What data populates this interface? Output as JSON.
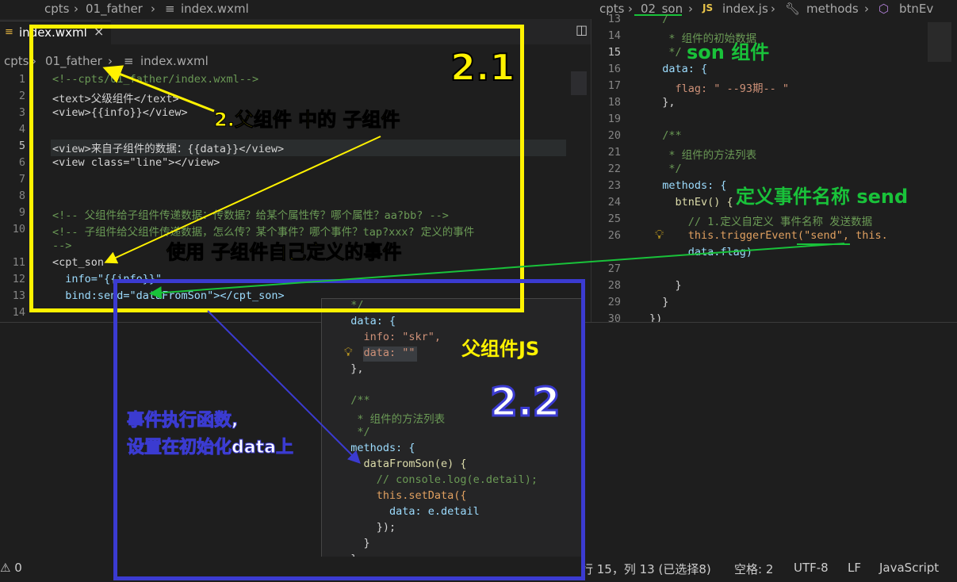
{
  "top_breadcrumb_left": {
    "seg1": "cpts",
    "seg2": "01_father",
    "seg3": "index.wxml"
  },
  "top_breadcrumb_right": {
    "seg1": "cpts",
    "seg2": "02_son",
    "seg3": "index.js",
    "seg4": "methods",
    "seg5": "btnEv",
    "js_badge": "JS"
  },
  "left_editor": {
    "tab_label": "index.wxml",
    "breadcrumb": {
      "seg1": "cpts",
      "seg2": "01_father",
      "seg3": "index.wxml"
    },
    "lines": [
      {
        "n": "1",
        "t": "<!--cpts/01_father/index.wxml-->"
      },
      {
        "n": "2",
        "t": "<text>父级组件</text>"
      },
      {
        "n": "3",
        "t": "<view>{{info}}</view>"
      },
      {
        "n": "4",
        "t": ""
      },
      {
        "n": "5",
        "t": "<view>来自子组件的数据：{{data}}</view>"
      },
      {
        "n": "6",
        "t": "<view class=\"line\"></view>"
      },
      {
        "n": "7",
        "t": ""
      },
      {
        "n": "8",
        "t": ""
      },
      {
        "n": "9",
        "t": "<!-- 父组件给子组件传递数据：传数据？给某个属性传？哪个属性？aa?bb? -->"
      },
      {
        "n": "10",
        "t": "<!-- 子组件给父组件传递数据，怎么传？某个事件？哪个事件？tap?xxx? 定义的事件"
      },
      {
        "n": "",
        "t": "-->"
      },
      {
        "n": "11",
        "t": "<cpt_son"
      },
      {
        "n": "12",
        "t": "  info=\"{{info}}\""
      },
      {
        "n": "13",
        "t": "  bind:send=\"dataFromSon\"></cpt_son>"
      },
      {
        "n": "14",
        "t": ""
      }
    ]
  },
  "right_editor": {
    "lines": [
      {
        "n": "13",
        "t": "  /"
      },
      {
        "n": "14",
        "t": "   * 组件的初始数据"
      },
      {
        "n": "15",
        "t": "   */"
      },
      {
        "n": "16",
        "t": "  data: {"
      },
      {
        "n": "17",
        "t": "    flag: \" --93期-- \""
      },
      {
        "n": "18",
        "t": "  },"
      },
      {
        "n": "19",
        "t": ""
      },
      {
        "n": "20",
        "t": "  /**"
      },
      {
        "n": "21",
        "t": "   * 组件的方法列表"
      },
      {
        "n": "22",
        "t": "   */"
      },
      {
        "n": "23",
        "t": "  methods: {"
      },
      {
        "n": "24",
        "t": "    btnEv() {"
      },
      {
        "n": "25",
        "t": "      // 1.定义自定义 事件名称 发送数据"
      },
      {
        "n": "26",
        "t": "      this.triggerEvent(\"send\", this."
      },
      {
        "n": "",
        "t": "      data.flag)"
      },
      {
        "n": "27",
        "t": ""
      },
      {
        "n": "28",
        "t": "    }"
      },
      {
        "n": "29",
        "t": "  }"
      },
      {
        "n": "30",
        "t": "})"
      }
    ]
  },
  "popup_code": {
    "lines": [
      "  */",
      "  data: {",
      "    info: \"skr\",",
      "    data: \"\"",
      "  },",
      "",
      "  /**",
      "   * 组件的方法列表",
      "   */",
      "  methods: {",
      "    dataFromSon(e) {",
      "      // console.log(e.detail);",
      "      this.setData({",
      "        data: e.detail",
      "      });",
      "    }",
      "  }",
      "})"
    ]
  },
  "annotations": {
    "label_2_1": "2.1",
    "label_2_2": "2.2",
    "father_child": "2.父组件 中的 子组件",
    "use_event": "使用 子组件自己定义的事件",
    "son_component": "son 组件",
    "define_event": "定义事件名称 send",
    "father_js": "父组件JS",
    "handler_line1": "事件执行函数,",
    "handler_line2": "设置在初始化data上"
  },
  "statusbar": {
    "problems": "⚠ 0",
    "position": "行 15，列 13 (已选择8)",
    "spaces": "空格: 2",
    "encoding": "UTF-8",
    "eol": "LF",
    "language": "JavaScript"
  },
  "colors": {
    "yellow": "#fff200",
    "green": "#19c23a",
    "blue": "#3b3bd1"
  }
}
